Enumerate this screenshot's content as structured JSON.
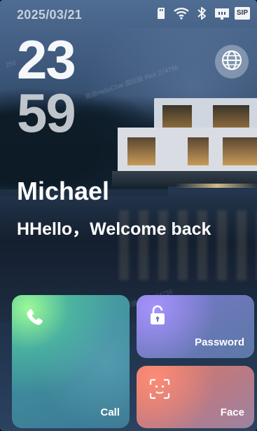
{
  "status_bar": {
    "date": "2025/03/21",
    "icons": [
      "sd-card-icon",
      "wifi-icon",
      "bluetooth-icon",
      "ethernet-icon",
      "sip-icon"
    ],
    "sip_label": "SIP"
  },
  "clock": {
    "hour": "23",
    "minute": "59"
  },
  "greeting": {
    "name": "Michael",
    "message": "HHello，Welcome back"
  },
  "actions": {
    "call": {
      "label": "Call",
      "icon": "phone-icon"
    },
    "password": {
      "label": "Password",
      "icon": "lock-icon"
    },
    "face": {
      "label": "Face",
      "icon": "face-scan-icon"
    }
  },
  "language_button": {
    "icon": "globe-icon"
  },
  "watermarks": [
    "256",
    "高级HelloChat 国际版 Rick 274756",
    "高级HelloChat 国际版 Rick 274756"
  ],
  "colors": {
    "call_card": "#4aa79d",
    "password_card": "#7a76d6",
    "face_card": "#d77864"
  }
}
